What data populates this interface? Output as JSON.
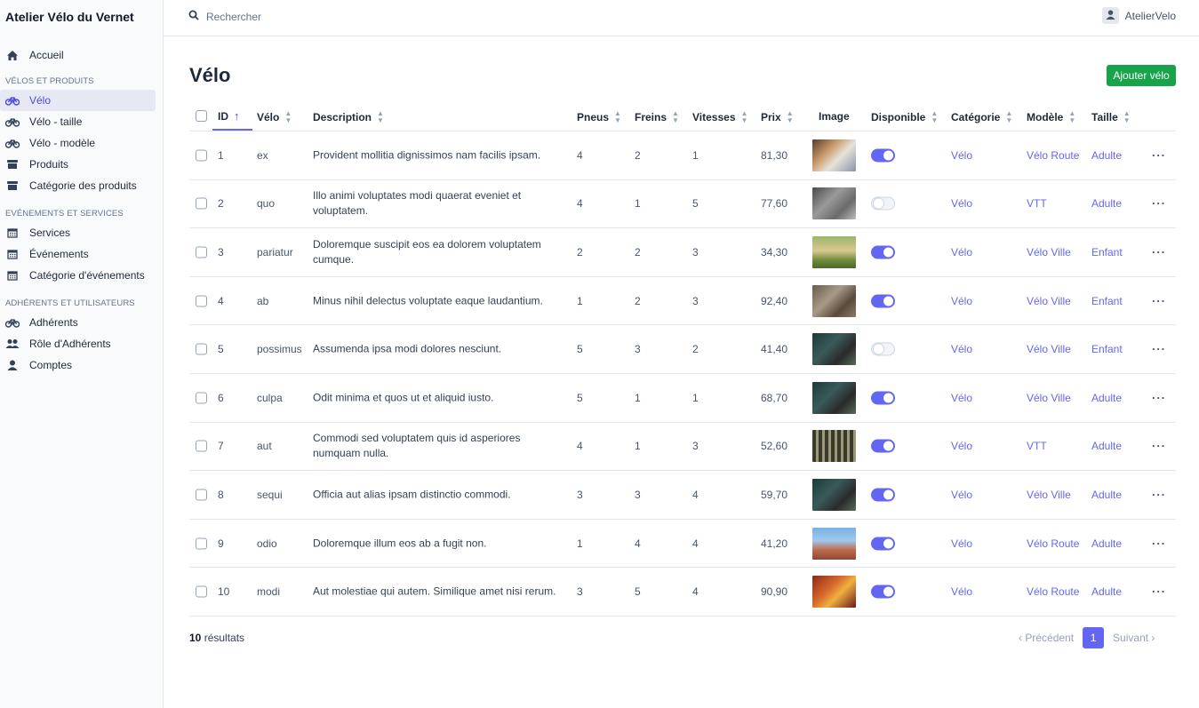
{
  "brand": "Atelier Vélo du Vernet",
  "search": {
    "placeholder": "Rechercher"
  },
  "user": {
    "name": "AtelierVelo"
  },
  "sidebar": {
    "home": "Accueil",
    "section1": "VÉLOS ET PRODUITS",
    "items1": [
      "Vélo",
      "Vélo - taille",
      "Vélo - modèle",
      "Produits",
      "Catégorie des produits"
    ],
    "section2": "EVÉNEMENTS ET SERVICES",
    "items2": [
      "Services",
      "Événements",
      "Catégorie d'événements"
    ],
    "section3": "ADHÉRENTS ET UTILISATEURS",
    "items3": [
      "Adhérents",
      "Rôle d'Adhérents",
      "Comptes"
    ]
  },
  "page": {
    "title": "Vélo",
    "add_label": "Ajouter vélo"
  },
  "table": {
    "headers": {
      "id": "ID",
      "velo": "Vélo",
      "description": "Description",
      "pneus": "Pneus",
      "freins": "Freins",
      "vitesses": "Vitesses",
      "prix": "Prix",
      "image": "Image",
      "disponible": "Disponible",
      "categorie": "Catégorie",
      "modele": "Modèle",
      "taille": "Taille"
    },
    "rows": [
      {
        "id": "1",
        "velo": "ex",
        "description": "Provident mollitia dignissimos nam facilis ipsam.",
        "pneus": "4",
        "freins": "2",
        "vitesses": "1",
        "prix": "81,30",
        "disponible": true,
        "categorie": "Vélo",
        "modele": "Vélo Route",
        "taille": "Adulte"
      },
      {
        "id": "2",
        "velo": "quo",
        "description": "Illo animi voluptates modi quaerat eveniet et voluptatem.",
        "pneus": "4",
        "freins": "1",
        "vitesses": "5",
        "prix": "77,60",
        "disponible": false,
        "categorie": "Vélo",
        "modele": "VTT",
        "taille": "Adulte"
      },
      {
        "id": "3",
        "velo": "pariatur",
        "description": "Doloremque suscipit eos ea dolorem voluptatem cumque.",
        "pneus": "2",
        "freins": "2",
        "vitesses": "3",
        "prix": "34,30",
        "disponible": true,
        "categorie": "Vélo",
        "modele": "Vélo Ville",
        "taille": "Enfant"
      },
      {
        "id": "4",
        "velo": "ab",
        "description": "Minus nihil delectus voluptate eaque laudantium.",
        "pneus": "1",
        "freins": "2",
        "vitesses": "3",
        "prix": "92,40",
        "disponible": true,
        "categorie": "Vélo",
        "modele": "Vélo Ville",
        "taille": "Enfant"
      },
      {
        "id": "5",
        "velo": "possimus",
        "description": "Assumenda ipsa modi dolores nesciunt.",
        "pneus": "5",
        "freins": "3",
        "vitesses": "2",
        "prix": "41,40",
        "disponible": false,
        "categorie": "Vélo",
        "modele": "Vélo Ville",
        "taille": "Enfant"
      },
      {
        "id": "6",
        "velo": "culpa",
        "description": "Odit minima et quos ut et aliquid iusto.",
        "pneus": "5",
        "freins": "1",
        "vitesses": "1",
        "prix": "68,70",
        "disponible": true,
        "categorie": "Vélo",
        "modele": "Vélo Ville",
        "taille": "Adulte"
      },
      {
        "id": "7",
        "velo": "aut",
        "description": "Commodi sed voluptatem quis id asperiores numquam nulla.",
        "pneus": "4",
        "freins": "1",
        "vitesses": "3",
        "prix": "52,60",
        "disponible": true,
        "categorie": "Vélo",
        "modele": "VTT",
        "taille": "Adulte"
      },
      {
        "id": "8",
        "velo": "sequi",
        "description": "Officia aut alias ipsam distinctio commodi.",
        "pneus": "3",
        "freins": "3",
        "vitesses": "4",
        "prix": "59,70",
        "disponible": true,
        "categorie": "Vélo",
        "modele": "Vélo Ville",
        "taille": "Adulte"
      },
      {
        "id": "9",
        "velo": "odio",
        "description": "Doloremque illum eos ab a fugit non.",
        "pneus": "1",
        "freins": "4",
        "vitesses": "4",
        "prix": "41,20",
        "disponible": true,
        "categorie": "Vélo",
        "modele": "Vélo Route",
        "taille": "Adulte"
      },
      {
        "id": "10",
        "velo": "modi",
        "description": "Aut molestiae qui autem. Similique amet nisi rerum.",
        "pneus": "3",
        "freins": "5",
        "vitesses": "4",
        "prix": "90,90",
        "disponible": true,
        "categorie": "Vélo",
        "modele": "Vélo Route",
        "taille": "Adulte"
      }
    ]
  },
  "footer": {
    "count": "10",
    "count_label": "résultats",
    "prev": "Précédent",
    "page": "1",
    "next": "Suivant"
  },
  "colors": {
    "accent": "#6366f1",
    "add_button": "#16a34a"
  }
}
